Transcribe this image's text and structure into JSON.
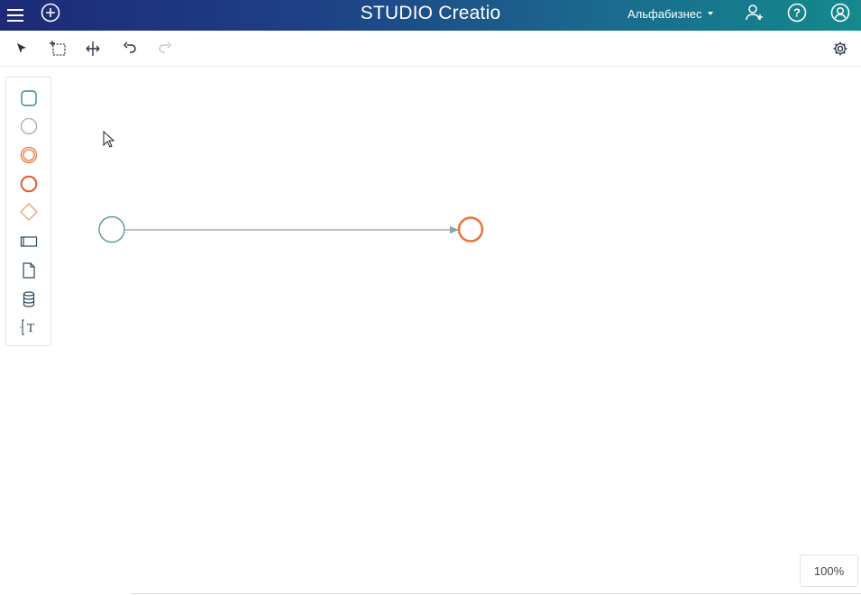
{
  "header": {
    "brand": "STUDIO Creatio",
    "workspace": "Альфабизнес",
    "icons": [
      "menu-icon",
      "add-circle-icon",
      "add-user-icon",
      "help-icon",
      "profile-icon"
    ]
  },
  "toolbar": {
    "tools": [
      "pointer-tool",
      "lasso-select-tool",
      "space-tool",
      "undo",
      "redo"
    ],
    "settings_icon": "gear-icon"
  },
  "palette": {
    "items": [
      "task",
      "start-event",
      "intermediate-event",
      "end-event",
      "gateway",
      "subprocess",
      "data-object",
      "data-store",
      "text-annotation"
    ]
  },
  "diagram": {
    "elements": [
      {
        "type": "start-event",
        "color": "#3a8a8a"
      },
      {
        "type": "sequence-flow",
        "color": "#8aa0ac"
      },
      {
        "type": "end-event",
        "color": "#e8743b"
      }
    ]
  },
  "zoom": {
    "label": "100%"
  },
  "colors": {
    "header_start": "#1d2a78",
    "header_end": "#138a8c",
    "accent_orange": "#e8743b",
    "teal": "#3a8a8a"
  }
}
